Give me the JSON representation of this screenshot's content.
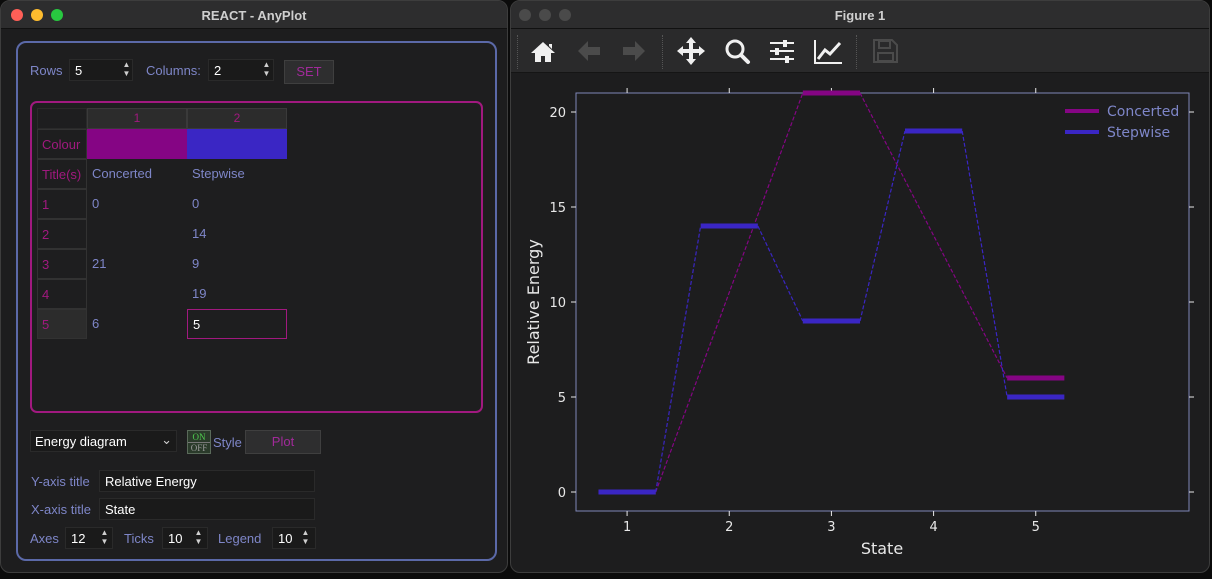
{
  "left_window": {
    "title": "REACT - AnyPlot",
    "rows_label": "Rows",
    "rows_value": "5",
    "columns_label": "Columns:",
    "columns_value": "2",
    "set_label": "SET",
    "table": {
      "col_headers": [
        "1",
        "2"
      ],
      "colour_label": "Colour",
      "titles_label": "Title(s)",
      "colours": [
        "#850584",
        "#3a26c4"
      ],
      "titles": [
        "Concerted",
        "Stepwise"
      ],
      "row_numbers": [
        "1",
        "2",
        "3",
        "4",
        "5"
      ],
      "rows": [
        [
          "0",
          "0"
        ],
        [
          "",
          "14"
        ],
        [
          "21",
          "9"
        ],
        [
          "",
          "19"
        ],
        [
          "6",
          "5"
        ]
      ]
    },
    "plot_type": "Energy diagram",
    "style_toggle_on": "ON",
    "style_toggle_off": "OFF",
    "style_label": "Style",
    "plot_label": "Plot",
    "y_axis_title_label": "Y-axis title",
    "y_axis_title_value": "Relative Energy",
    "x_axis_title_label": "X-axis title",
    "x_axis_title_value": "State",
    "axes_label": "Axes",
    "axes_value": "12",
    "ticks_label": "Ticks",
    "ticks_value": "10",
    "legend_label": "Legend",
    "legend_value": "10"
  },
  "right_window": {
    "title": "Figure 1",
    "toolbar_icons": [
      "home-icon",
      "back-arrow-icon",
      "forward-arrow-icon",
      "pan-move-icon",
      "zoom-magnifier-icon",
      "subplots-sliders-icon",
      "customize-lines-icon",
      "save-disk-icon"
    ]
  },
  "chart_data": {
    "type": "line",
    "style": "energy-diagram",
    "xlabel": "State",
    "ylabel": "Relative Energy",
    "x_ticks": [
      "1",
      "2",
      "3",
      "4",
      "5"
    ],
    "y_ticks": [
      "0",
      "5",
      "10",
      "15",
      "20"
    ],
    "xlim": [
      0.5,
      6.5
    ],
    "ylim": [
      -1,
      21
    ],
    "grid": false,
    "legend_position": "top-right",
    "series": [
      {
        "name": "Concerted",
        "color": "#850584",
        "points": [
          [
            1,
            0
          ],
          [
            3,
            21
          ],
          [
            5,
            6
          ]
        ]
      },
      {
        "name": "Stepwise",
        "color": "#3a26c4",
        "points": [
          [
            1,
            0
          ],
          [
            2,
            14
          ],
          [
            3,
            9
          ],
          [
            4,
            19
          ],
          [
            5,
            5
          ]
        ]
      }
    ]
  },
  "colors": {
    "frame_border": "#5b69a8",
    "table_border": "#a1197f",
    "label_text": "#7e86c8",
    "accent_text": "#a12a9a"
  }
}
